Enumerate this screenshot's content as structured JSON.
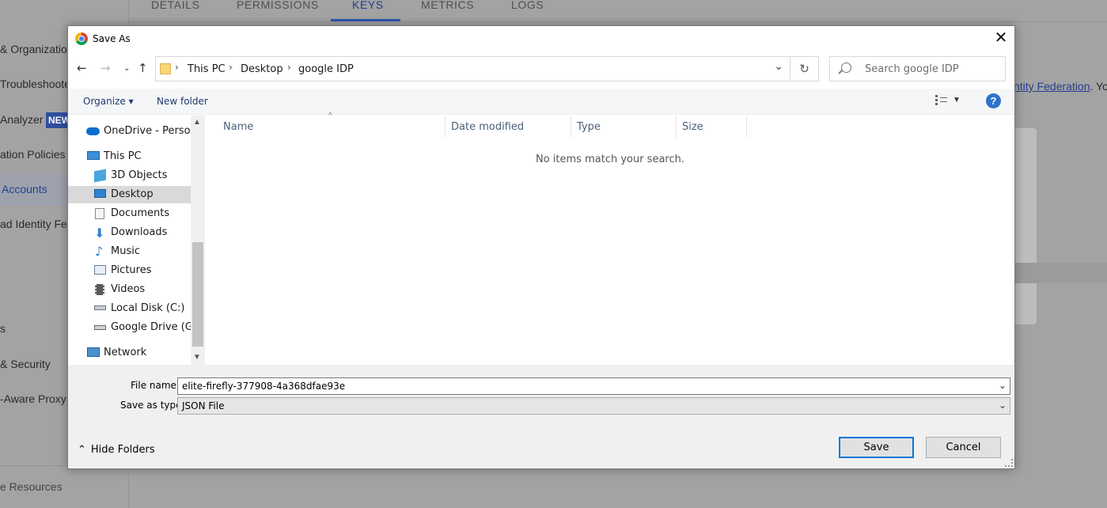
{
  "background": {
    "tabs": [
      "DETAILS",
      "PERMISSIONS",
      "KEYS",
      "METRICS",
      "LOGS"
    ],
    "active_tab": "KEYS",
    "sidebar_items": [
      "& Organization",
      "Troubleshooter",
      "Analyzer",
      "ation Policies",
      "Accounts",
      "ad Identity Fed",
      "s",
      "& Security",
      "-Aware Proxy"
    ],
    "new_badge": "NEW",
    "sidebar_footer": "e Resources",
    "link_text": "ntity Federation",
    "link_suffix": ". Yo"
  },
  "dialog": {
    "title": "Save As",
    "close_glyph": "✕",
    "breadcrumbs": [
      "This PC",
      "Desktop",
      "google IDP"
    ],
    "search_placeholder": "Search google IDP",
    "commands": {
      "organize": "Organize ▾",
      "new_folder": "New folder"
    },
    "help_glyph": "?",
    "nav_items": [
      {
        "label": "OneDrive - Personal",
        "icon": "onedrive-icon"
      },
      {
        "label": "This PC",
        "icon": "pc-icon"
      },
      {
        "label": "3D Objects",
        "icon": "3d-objects-icon"
      },
      {
        "label": "Desktop",
        "icon": "desktop-icon",
        "selected": true
      },
      {
        "label": "Documents",
        "icon": "documents-icon"
      },
      {
        "label": "Downloads",
        "icon": "downloads-icon"
      },
      {
        "label": "Music",
        "icon": "music-icon"
      },
      {
        "label": "Pictures",
        "icon": "pictures-icon"
      },
      {
        "label": "Videos",
        "icon": "videos-icon"
      },
      {
        "label": "Local Disk (C:)",
        "icon": "drive-icon"
      },
      {
        "label": "Google Drive (G:)",
        "icon": "drive-icon"
      },
      {
        "label": "Network",
        "icon": "network-icon"
      }
    ],
    "columns": [
      "Name",
      "Date modified",
      "Type",
      "Size"
    ],
    "empty_message": "No items match your search.",
    "file_name_label": "File name:",
    "file_name_value": "elite-firefly-377908-4a368dfae93e",
    "save_type_label": "Save as type:",
    "save_type_value": "JSON File",
    "hide_folders": "Hide Folders",
    "save_button": "Save",
    "cancel_button": "Cancel"
  }
}
